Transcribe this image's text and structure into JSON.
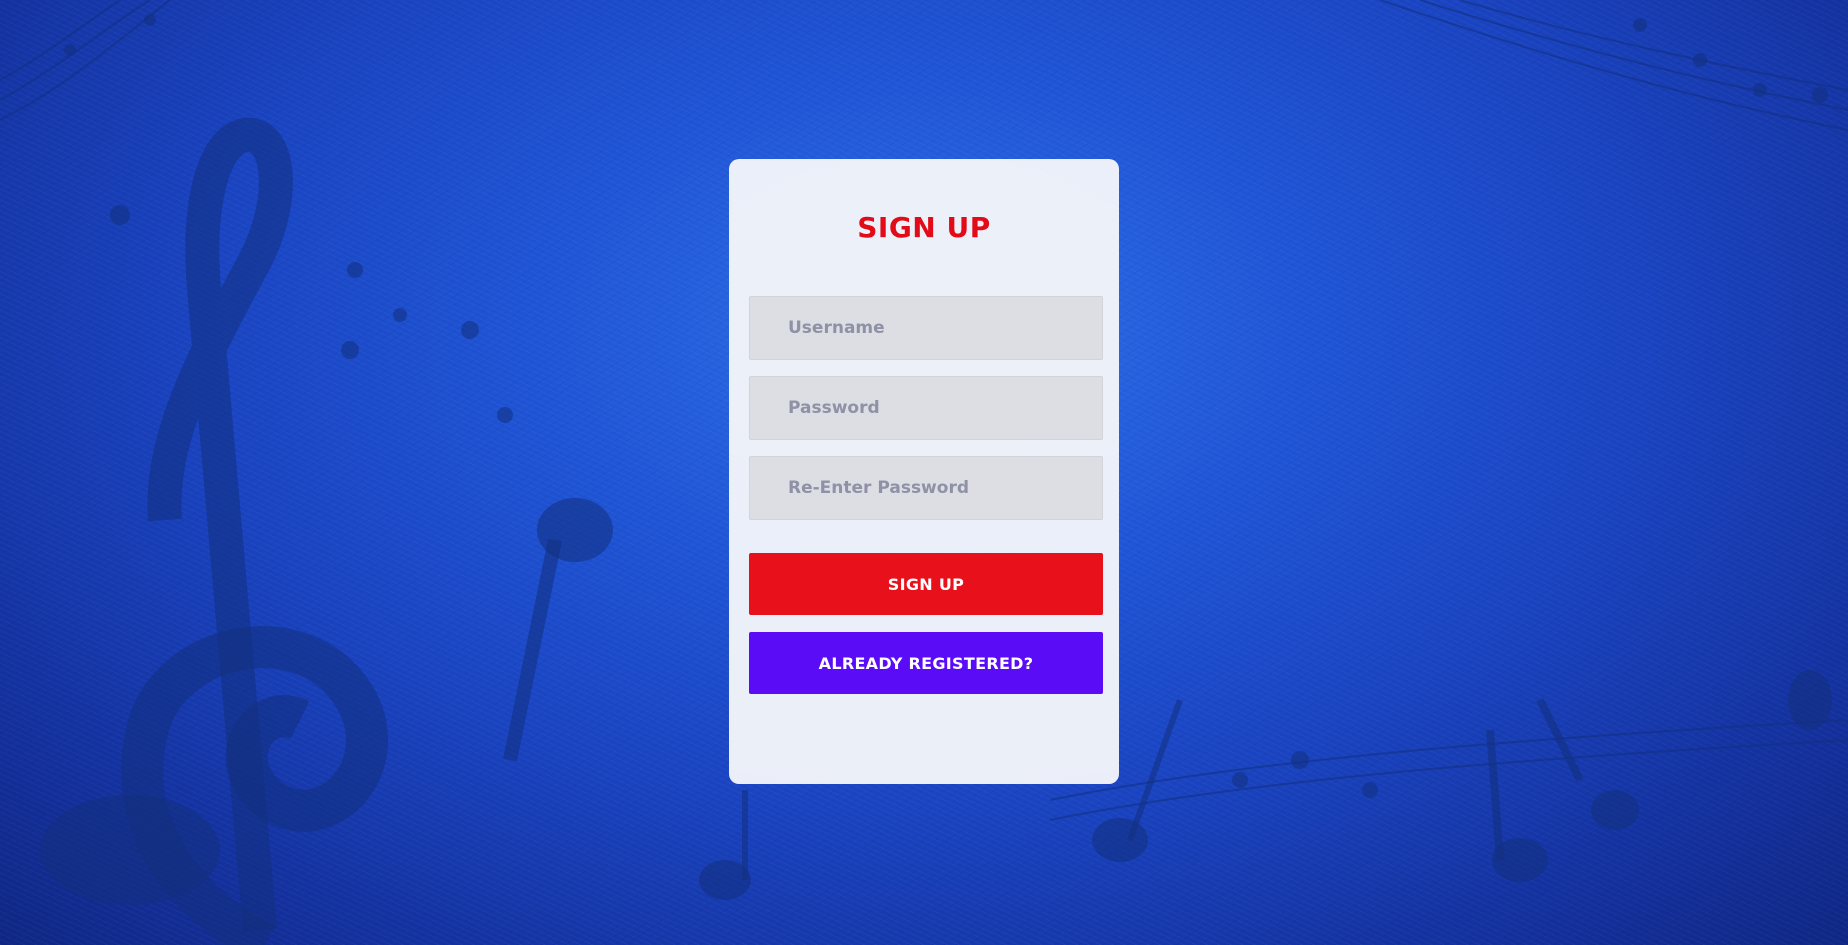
{
  "form": {
    "title": "SIGN UP",
    "username_placeholder": "Username",
    "password_placeholder": "Password",
    "repassword_placeholder": "Re-Enter Password",
    "signup_button_label": "SIGN UP",
    "already_registered_label": "ALREADY REGISTERED?"
  },
  "colors": {
    "title": "#e30b17",
    "signup_button": "#e8101a",
    "already_registered_button": "#5a0cf7",
    "background": "#1f55d6"
  },
  "background": {
    "decoration": "music-notes-icon"
  }
}
